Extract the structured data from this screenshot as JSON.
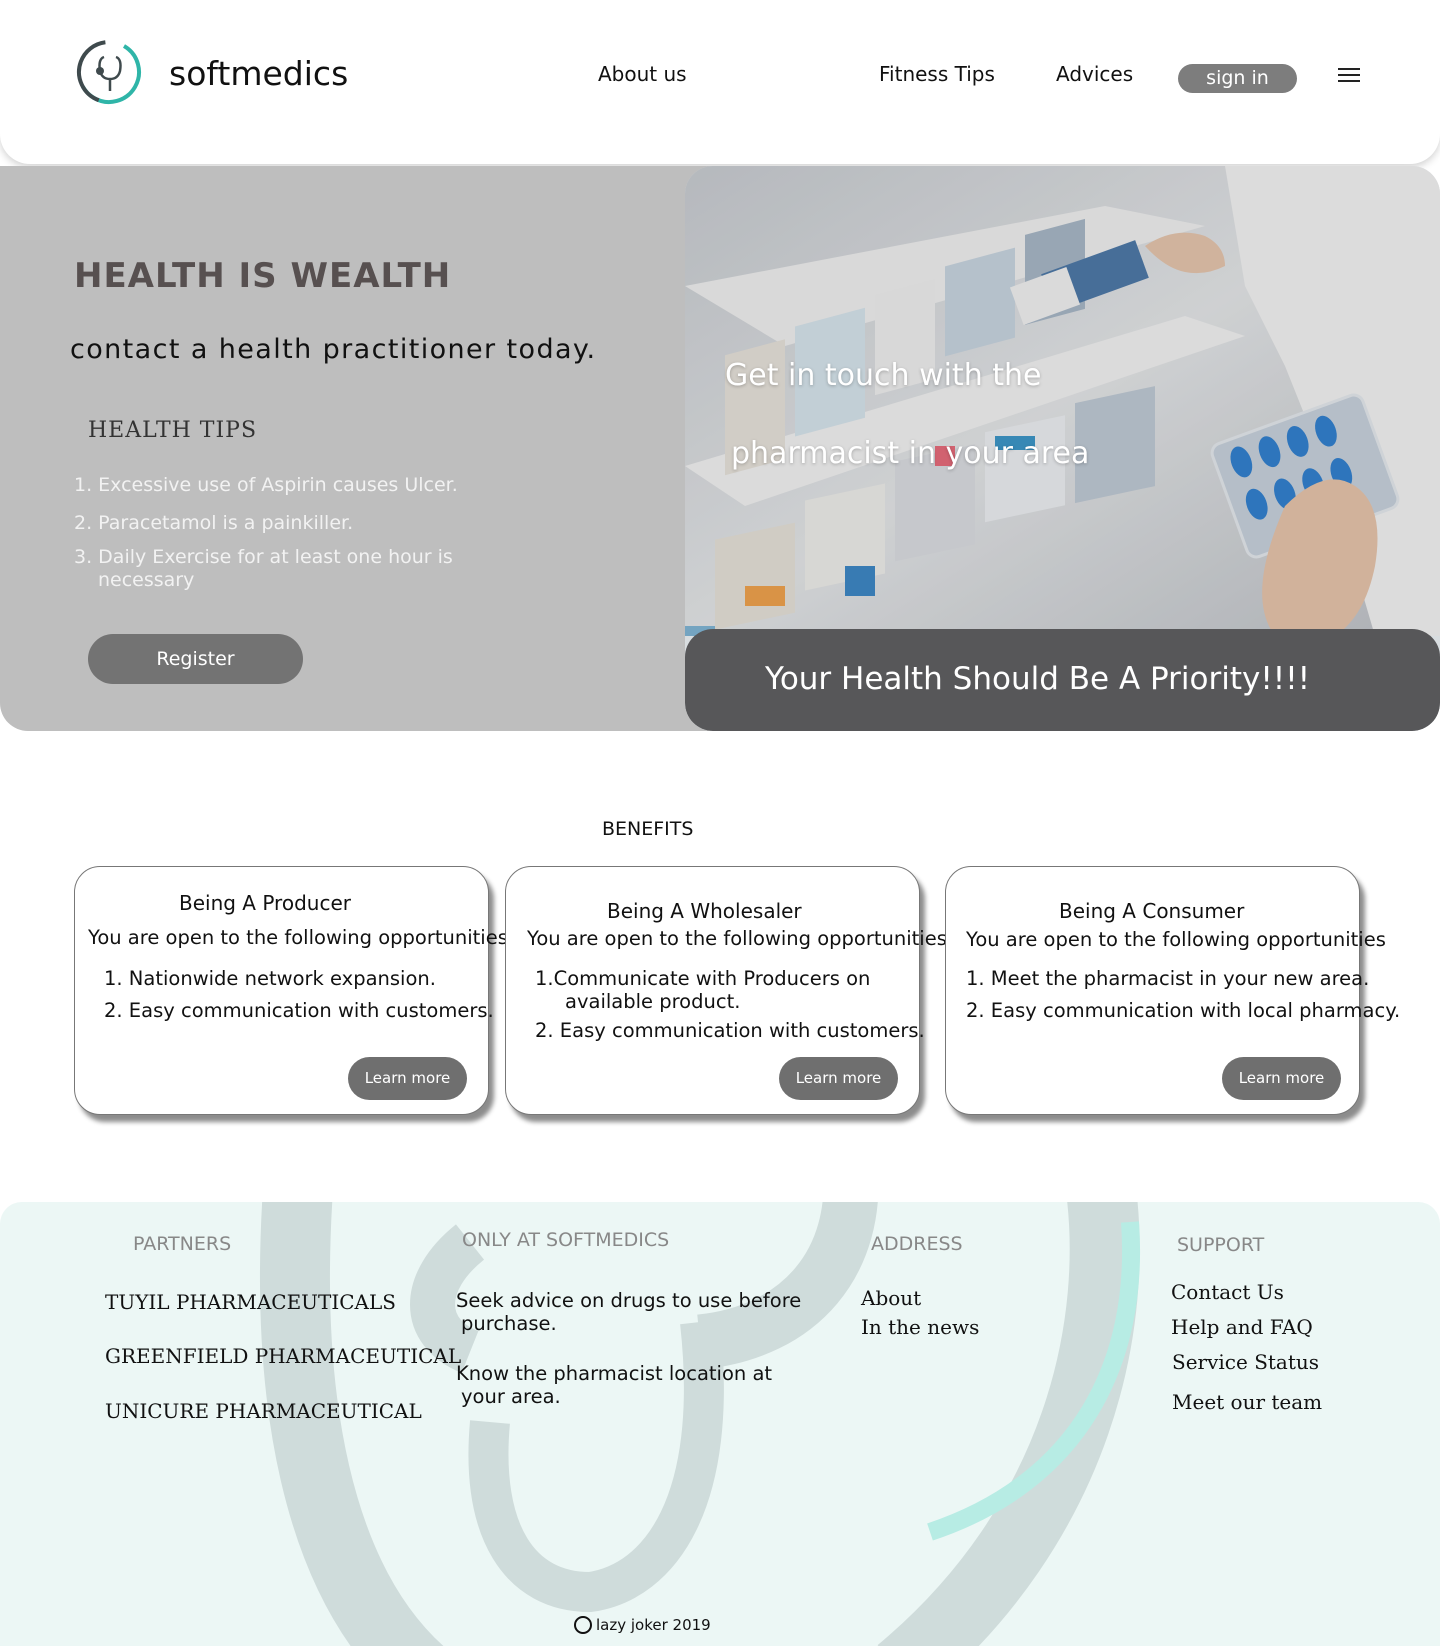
{
  "header": {
    "brand": "softmedics",
    "nav": [
      "About us",
      "Fitness Tips",
      "Advices"
    ],
    "signin_label": "sign in"
  },
  "hero": {
    "title": "HEALTH IS WEALTH",
    "subtitle": "contact a health practitioner today.",
    "tips_heading": "HEALTH TIPS",
    "tips": [
      "1. Excessive use of Aspirin causes Ulcer.",
      "2. Paracetamol is a painkiller.",
      "3. Daily Exercise for at least one hour is",
      "necessary"
    ],
    "register_label": "Register",
    "photo_text_1": "Get in touch with the",
    "photo_text_2": "pharmacist in your area",
    "priority": "Your Health Should Be A Priority!!!!"
  },
  "benefits": {
    "heading": "BENEFITS",
    "cards": [
      {
        "title": "Being A Producer",
        "subtitle": "You are open to the following opportunities",
        "items": [
          "1. Nationwide network expansion.",
          "2. Easy communication with customers."
        ],
        "button": "Learn more"
      },
      {
        "title": "Being A Wholesaler",
        "subtitle": "You are open to the following opportunities",
        "items": [
          "1.Communicate with Producers on",
          "available product.",
          "2. Easy communication with customers."
        ],
        "button": "Learn more"
      },
      {
        "title": "Being A Consumer",
        "subtitle": "You are open to the following opportunities",
        "items": [
          "1. Meet the pharmacist in your new area.",
          "2. Easy communication with local pharmacy."
        ],
        "button": "Learn more"
      }
    ]
  },
  "footer": {
    "partners": {
      "heading": "PARTNERS",
      "items": [
        "TUYIL PHARMACEUTICALS",
        "GREENFIELD PHARMACEUTICAL",
        "UNICURE PHARMACEUTICAL"
      ]
    },
    "only": {
      "heading": "ONLY AT SOFTMEDICS",
      "items": [
        "Seek advice on drugs to use before",
        "purchase.",
        "Know the pharmacist location at",
        "your area."
      ]
    },
    "address": {
      "heading": "ADDRESS",
      "items": [
        "About",
        "In the news"
      ]
    },
    "support": {
      "heading": "SUPPORT",
      "items": [
        "Contact Us",
        "Help and FAQ",
        "Service Status",
        "Meet our team"
      ]
    },
    "copyright": "lazy joker 2019"
  },
  "colors": {
    "accent_teal": "#2fb5a8",
    "hero_gray": "#bebebe",
    "priority_bg": "#575759",
    "button_gray": "#737373",
    "footer_bg": "#ecf7f5"
  }
}
